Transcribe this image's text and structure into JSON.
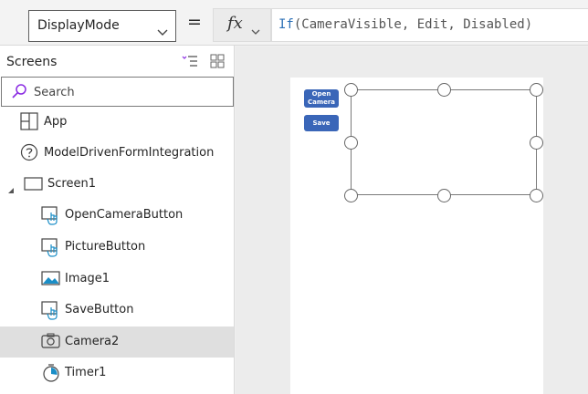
{
  "formula_bar": {
    "property": "DisplayMode",
    "equals": "=",
    "fx_label": "fx",
    "formula": {
      "fn": "If",
      "args": "(CameraVisible, Edit, Disabled)"
    }
  },
  "screens_panel": {
    "title": "Screens",
    "search_placeholder": "Search",
    "items": [
      {
        "label": "App",
        "icon": "app-grid-icon"
      },
      {
        "label": "ModelDrivenFormIntegration",
        "icon": "help-circle-icon"
      },
      {
        "label": "Screen1",
        "icon": "screen-icon"
      },
      {
        "label": "OpenCameraButton",
        "icon": "button-icon"
      },
      {
        "label": "PictureButton",
        "icon": "button-icon"
      },
      {
        "label": "Image1",
        "icon": "image-icon"
      },
      {
        "label": "SaveButton",
        "icon": "button-icon"
      },
      {
        "label": "Camera2",
        "icon": "camera-icon"
      },
      {
        "label": "Timer1",
        "icon": "timer-icon"
      }
    ],
    "selected": "Camera2"
  },
  "canvas": {
    "open_camera_line1": "Open",
    "open_camera_line2": "Camera",
    "save_label": "Save"
  },
  "colors": {
    "accent": "#3a66b8",
    "selected_row": "#dfdfdf",
    "formula_fn": "#2b6fb6",
    "search_icon": "#8a2be2"
  }
}
